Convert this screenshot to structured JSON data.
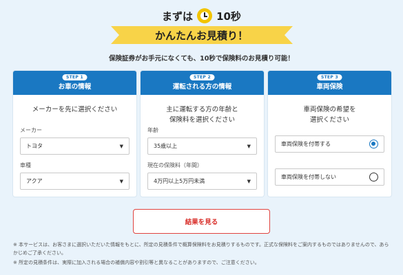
{
  "header": {
    "pre": "まずは",
    "seconds": "10秒",
    "ribbon": "かんたんお見積り！",
    "subtitle": "保険証券がお手元になくても、10秒で保険料のお見積り可能！"
  },
  "steps": [
    {
      "badge": "STEP 1",
      "title": "お車の情報",
      "desc_lines": [
        "メーカーを先に選択ください"
      ],
      "fields": [
        {
          "label": "メーカー",
          "value": "トヨタ"
        },
        {
          "label": "車種",
          "value": "アクア"
        }
      ]
    },
    {
      "badge": "STEP 2",
      "title": "運転される方の情報",
      "desc_lines": [
        "主に運転する方の年齢と",
        "保険料を選択ください"
      ],
      "fields": [
        {
          "label": "年齢",
          "value": "35歳以上"
        },
        {
          "label": "現在の保険料（年間）",
          "value": "4万円以上5万円未満"
        }
      ]
    },
    {
      "badge": "STEP 3",
      "title": "車両保険",
      "desc_lines": [
        "車両保険の希望を",
        "選択ください"
      ],
      "options": [
        {
          "label": "車両保険を付帯する",
          "selected": true
        },
        {
          "label": "車両保険を付帯しない",
          "selected": false
        }
      ]
    }
  ],
  "button": {
    "label": "結果を見る"
  },
  "notes": [
    "※ 本サービスは、お客さまに選択いただいた情報をもとに、所定の見積条件で概算保険料をお見積りするものです。正式な保険料をご案内するものではありませんので、あらかじめご了承ください。",
    "※ 所定の見積条件は、実際に加入される場合の補償内容や割引等と異なることがありますので、ご注意ください。"
  ],
  "colors": {
    "background": "#e9f3fb",
    "header_blue": "#1a78c2",
    "ribbon_yellow": "#f8d348",
    "button_red": "#e0433e"
  },
  "icons": {
    "timer": "stopwatch-icon",
    "caret": "triangle-down-icon"
  }
}
